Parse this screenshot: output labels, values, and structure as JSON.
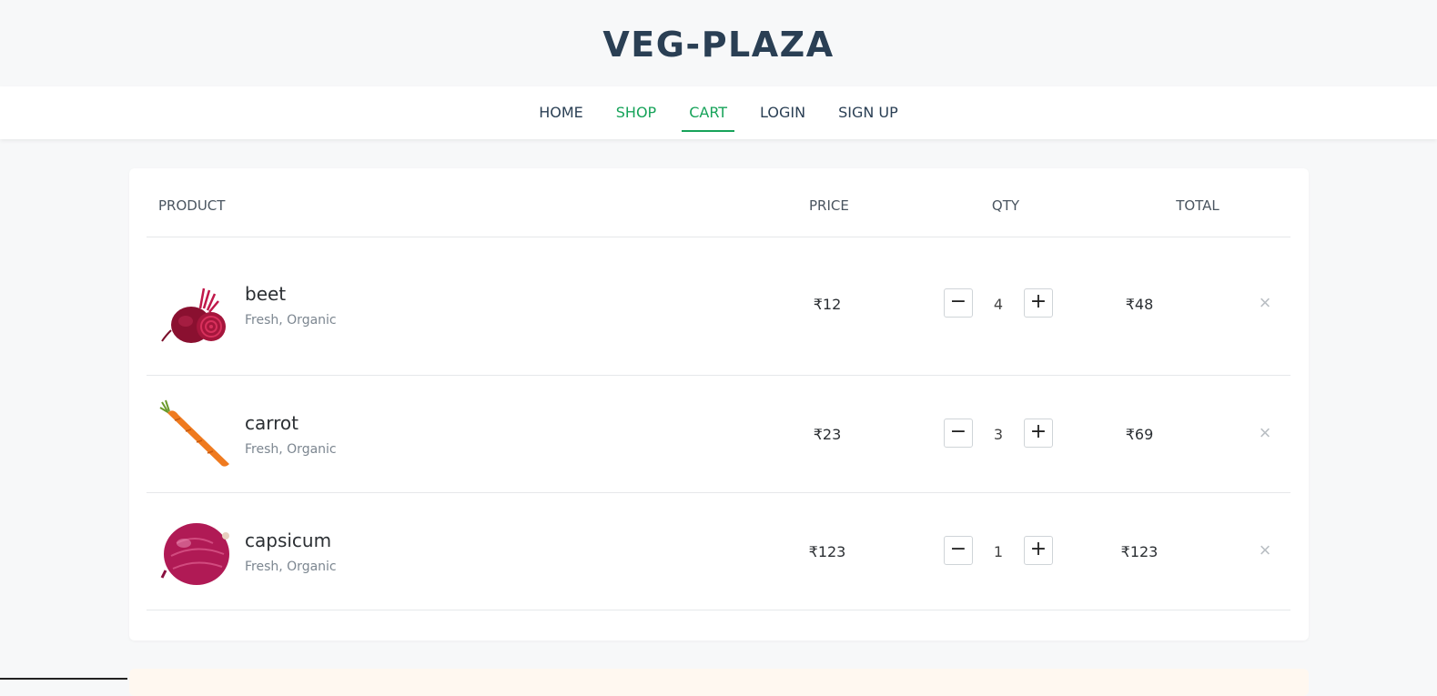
{
  "site": {
    "title": "VEG-PLAZA"
  },
  "nav": {
    "items": [
      {
        "label": "HOME"
      },
      {
        "label": "SHOP"
      },
      {
        "label": "CART"
      },
      {
        "label": "LOGIN"
      },
      {
        "label": "SIGN UP"
      }
    ],
    "active": "CART",
    "accent_color": "#17a35a"
  },
  "cart": {
    "columns": {
      "product": "PRODUCT",
      "price": "PRICE",
      "qty": "QTY",
      "total": "TOTAL"
    },
    "items": [
      {
        "name": "beet",
        "description": "Fresh, Organic",
        "price": "₹12",
        "qty": "4",
        "total": "₹48",
        "image": "beetroot-image"
      },
      {
        "name": "carrot",
        "description": "Fresh, Organic",
        "price": "₹23",
        "qty": "3",
        "total": "₹69",
        "image": "carrot-image"
      },
      {
        "name": "capsicum",
        "description": "Fresh, Organic",
        "price": "₹123",
        "qty": "1",
        "total": "₹123",
        "image": "red-onion-image"
      }
    ],
    "controls": {
      "decrease": "−",
      "increase": "+",
      "remove": "×"
    }
  }
}
